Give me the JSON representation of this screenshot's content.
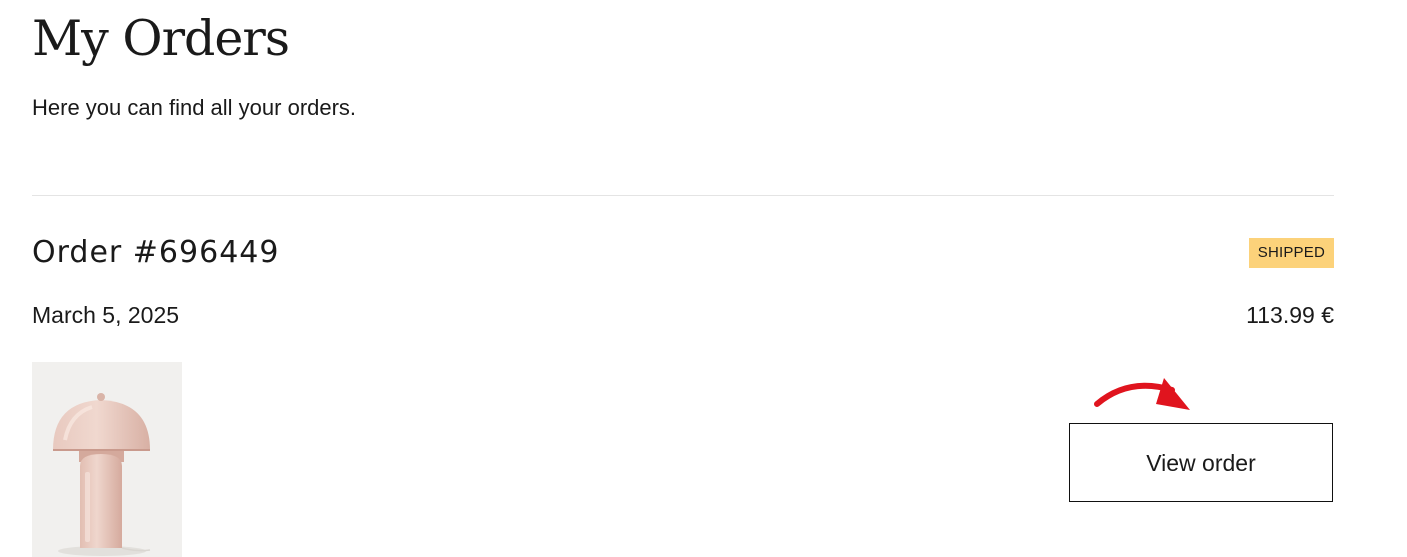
{
  "header": {
    "title": "My Orders",
    "subtitle": "Here you can find all your orders."
  },
  "orders": [
    {
      "title": "Order #696449",
      "status": "SHIPPED",
      "date": "March 5, 2025",
      "total": "113.99 €",
      "product_image": {
        "icon": "table-lamp-image",
        "lamp_color": "#e6c3b8",
        "background": "#f1f0ee"
      },
      "view_button_label": "View order"
    }
  ],
  "colors": {
    "status_shipped": "#fcd27a",
    "annotation_arrow": "#e0141e",
    "divider": "#e4e4e4"
  }
}
